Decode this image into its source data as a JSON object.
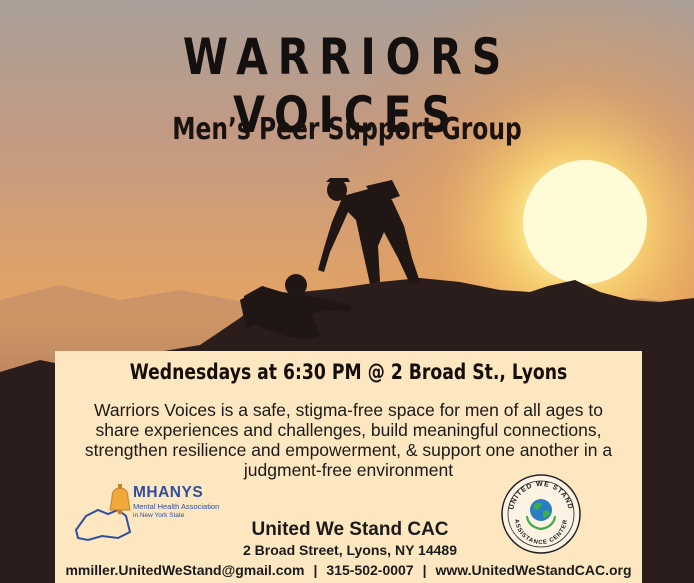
{
  "title": "WARRIORS VOICES",
  "subtitle": "Men’s Peer Support Group",
  "schedule": "Wednesdays at 6:30 PM @ 2 Broad St., Lyons",
  "description": [
    "Warriors Voices is a safe, stigma-free space for men of all ages to",
    "share experiences and challenges, build meaningful connections,",
    "strengthen resilience and empowerment, & support one another in a",
    "judgment-free environment"
  ],
  "mhanys": {
    "name": "MHANYS",
    "line1": "Mental Health Association",
    "line2": "in New York State"
  },
  "organization": {
    "name": "United We Stand CAC",
    "address": "2 Broad Street, Lyons, NY 14489"
  },
  "contact": {
    "email": "mmiller.UnitedWeStand@gmail.com",
    "separator": "|",
    "phone": "315-502-0007",
    "website": "www.UnitedWeStandCAC.org"
  },
  "seal": {
    "top_text": "UNITED WE STAND",
    "bottom_text": "ASSISTANCE CENTER"
  },
  "colors": {
    "box": "#fde7c1",
    "mhanys_blue": "#2f4e9e",
    "sun": "#fff6b0"
  }
}
